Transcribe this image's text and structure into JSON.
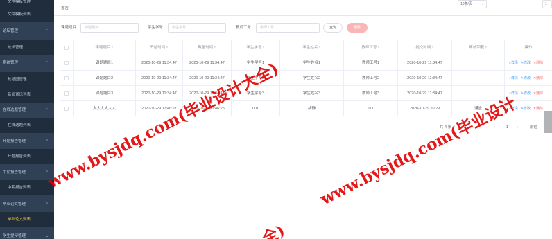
{
  "sidebar": {
    "items": [
      {
        "label": "文件模板管理",
        "kind": "group"
      },
      {
        "label": "文件模板列表",
        "kind": "sub"
      },
      {
        "label": "论坛管理",
        "kind": "group"
      },
      {
        "label": "论坛管理",
        "kind": "sub"
      },
      {
        "label": "系统管理",
        "kind": "group"
      },
      {
        "label": "轮播图管理",
        "kind": "sub"
      },
      {
        "label": "新闻资讯列表",
        "kind": "sub"
      },
      {
        "label": "在线选题管理",
        "kind": "group"
      },
      {
        "label": "在线选题列表",
        "kind": "sub"
      },
      {
        "label": "开题报告管理",
        "kind": "group"
      },
      {
        "label": "开题报告列表",
        "kind": "sub"
      },
      {
        "label": "中期报告管理",
        "kind": "group"
      },
      {
        "label": "中期报告列表",
        "kind": "sub"
      },
      {
        "label": "毕业论文管理",
        "kind": "group"
      },
      {
        "label": "毕业论文列表",
        "kind": "sub-active"
      },
      {
        "label": "学生提辩管理",
        "kind": "group"
      }
    ]
  },
  "breadcrumb": "首页",
  "search": {
    "title_label": "课题题目",
    "title_placeholder": "课题题目",
    "student_no_label": "学生学号",
    "student_no_placeholder": "学生学号",
    "teacher_no_label": "教师工号",
    "teacher_no_placeholder": "教师工号",
    "query_button": "查询",
    "delete_button": "删除"
  },
  "table": {
    "headers": [
      "课题题目",
      "开始时间",
      "截至时间",
      "学生学号",
      "学生姓名",
      "教师工号",
      "提交时间",
      "审核回复",
      "操作"
    ],
    "rows": [
      {
        "title": "课题题目1",
        "start": "2020-10-29 11:34:47",
        "end": "2020-10-29 11:34:47",
        "student_no": "学生学号1",
        "student_name": "学生姓名1",
        "teacher_no": "教师工号1",
        "submit": "2020-10-29 11:34:47",
        "reply": ""
      },
      {
        "title": "课题题目2",
        "start": "2020-10-29 11:34:47",
        "end": "2020-10-29 11:34:47",
        "student_no": "学生学号2",
        "student_name": "学生姓名2",
        "teacher_no": "教师工号2",
        "submit": "2020-10-29 11:34:47",
        "reply": ""
      },
      {
        "title": "课题题目3",
        "start": "2020-10-29 11:34:47",
        "end": "2020-10-29 11:34:47",
        "student_no": "学生学号3",
        "student_name": "学生姓名3",
        "teacher_no": "教师工号3",
        "submit": "2020-10-29 11:34:47",
        "reply": ""
      },
      {
        "title": "大大大大大大",
        "start": "2020-10-29 11:46:27",
        "end": "2020-10-29 11:46:25",
        "student_no": "001",
        "student_name": "胡静",
        "teacher_no": "111",
        "submit": "2020-10-29 10:29",
        "reply": "通告"
      }
    ],
    "ops": {
      "detail": "详情",
      "edit": "修改",
      "delete": "删除"
    }
  },
  "pagination": {
    "total": "共 4 条",
    "page_size": "10条/页",
    "prev": "‹",
    "current": "1",
    "next": "›",
    "goto": "前往",
    "goto_value": "1"
  },
  "watermark": {
    "text1": "www.bysjdq.com(毕业设计大全)",
    "text2": "www.bysjdq.com(毕业设计",
    "text3": "全)"
  },
  "colors": {
    "sidebar_bg": "#304156",
    "sidebar_active": "#ffd04b",
    "watermark": "#e00000",
    "link": "#409eff",
    "danger": "#f56c6c"
  }
}
